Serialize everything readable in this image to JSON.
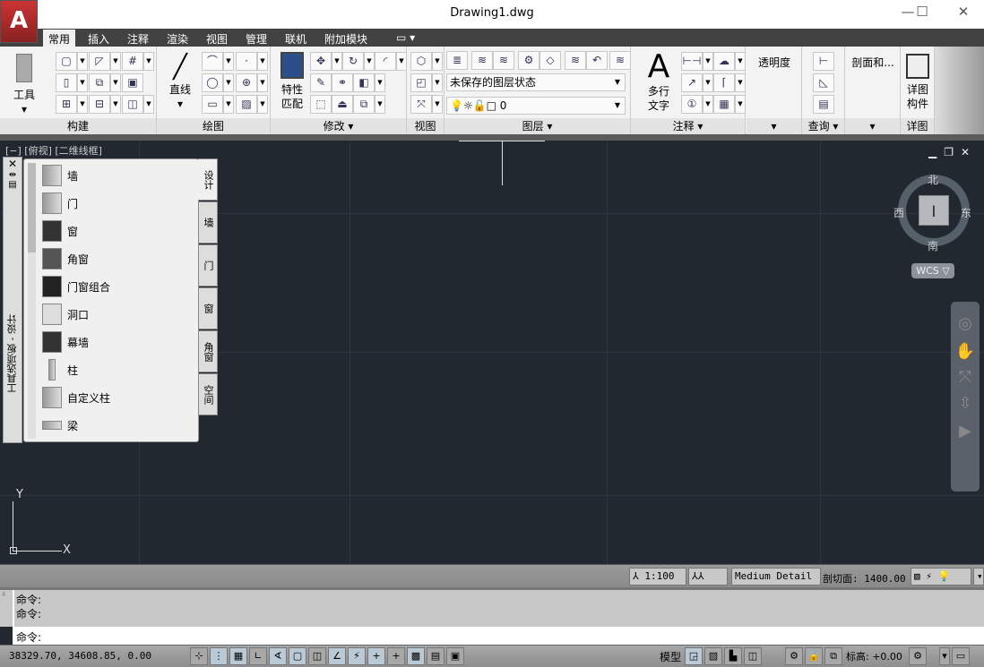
{
  "window": {
    "title": "Drawing1.dwg",
    "app_button": "A",
    "minimize": "—",
    "maximize": "☐",
    "close": "✕"
  },
  "tabs": [
    "常用",
    "插入",
    "注释",
    "渲染",
    "视图",
    "管理",
    "联机",
    "附加模块"
  ],
  "tab_extra": "▭ ▾",
  "panels": {
    "build": "构建",
    "draw": "绘图",
    "modify": "修改 ▾",
    "view": "视图",
    "layers": "图层 ▾",
    "annotation": "注释 ▾",
    "transparency_arrow": "▾",
    "query": "查询 ▾",
    "section_arrow": "▾",
    "detail": "详图"
  },
  "big_buttons": {
    "tools": "工具",
    "line": "直线",
    "match_props_1": "特性",
    "match_props_2": "匹配",
    "mtext_1": "多行",
    "mtext_2": "文字",
    "transparency": "透明度",
    "section": "剖面和...",
    "detail_1": "详图",
    "detail_2": "构件",
    "mtext_glyph": "A"
  },
  "layer_state": "未保存的图层状态",
  "layer_current": "0",
  "viewport_label": "[−] [俯视] [二维线框]",
  "palette": {
    "title": "工具选项板 - 设计",
    "items": [
      "墙",
      "门",
      "窗",
      "角窗",
      "门窗组合",
      "洞口",
      "幕墙",
      "柱",
      "自定义柱",
      "梁"
    ],
    "tabs": [
      "设计",
      "墙",
      "门",
      "窗",
      "角窗",
      "空间"
    ],
    "close": "✕"
  },
  "viewcube": {
    "north": "北",
    "south": "南",
    "east": "东",
    "west": "西",
    "wcs": "WCS ▽"
  },
  "viewport_controls": {
    "min": "▁",
    "restore": "❐",
    "close": "✕"
  },
  "ucs": {
    "x": "X",
    "y": "Y"
  },
  "status_strip": {
    "scale": "⅄ 1:100 ▾",
    "detail": "Medium Detail ▾",
    "cut_plane": "剖切面: 1400.00"
  },
  "command": {
    "history": [
      "命令:",
      "命令:"
    ],
    "prompt": "命令:"
  },
  "statusbar": {
    "coords": "38329.70,  34608.85, 0.00",
    "model": "模型",
    "elevation": "标高: +0.00"
  }
}
